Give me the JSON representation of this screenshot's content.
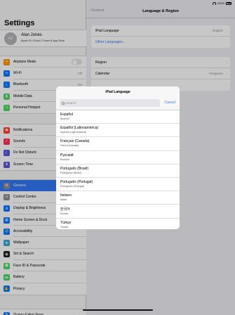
{
  "status": {
    "time": "10:00",
    "battery": "100%"
  },
  "sidebar": {
    "title": "Settings",
    "profile": {
      "initials": "AJ",
      "name": "Alan Jones",
      "subtitle": "Apple ID, iCloud, iTunes & App Store"
    },
    "group1": [
      {
        "label": "Airplane Mode",
        "icon": "airplane-icon",
        "color": "#ff9500",
        "toggle": "off"
      },
      {
        "label": "Wi-Fi",
        "icon": "wifi-icon",
        "color": "#007aff",
        "value": "Off"
      },
      {
        "label": "Bluetooth",
        "icon": "bluetooth-icon",
        "color": "#007aff",
        "value": "On"
      },
      {
        "label": "Mobile Data",
        "icon": "antenna-icon",
        "color": "#4cd964"
      },
      {
        "label": "Personal Hotspot",
        "icon": "hotspot-icon",
        "color": "#4cd964"
      }
    ],
    "group2": [
      {
        "label": "Notifications",
        "icon": "notifications-icon",
        "color": "#ff3b30"
      },
      {
        "label": "Sounds",
        "icon": "speaker-icon",
        "color": "#ff2d55"
      },
      {
        "label": "Do Not Disturb",
        "icon": "moon-icon",
        "color": "#5856d6"
      },
      {
        "label": "Screen Time",
        "icon": "hourglass-icon",
        "color": "#5856d6"
      }
    ],
    "group3": [
      {
        "label": "General",
        "icon": "gear-icon",
        "color": "#8e8e93",
        "selected": true
      },
      {
        "label": "Control Centre",
        "icon": "control-centre-icon",
        "color": "#8e8e93"
      },
      {
        "label": "Display & Brightness",
        "icon": "display-icon",
        "color": "#007aff"
      },
      {
        "label": "Home Screen & Dock",
        "icon": "home-screen-icon",
        "color": "#007aff"
      },
      {
        "label": "Accessibility",
        "icon": "accessibility-icon",
        "color": "#007aff"
      },
      {
        "label": "Wallpaper",
        "icon": "wallpaper-icon",
        "color": "#34aadc"
      },
      {
        "label": "Siri & Search",
        "icon": "siri-icon",
        "color": "#222222"
      },
      {
        "label": "Face ID & Passcode",
        "icon": "face-id-icon",
        "color": "#4cd964"
      },
      {
        "label": "Battery",
        "icon": "battery-icon",
        "color": "#4cd964"
      },
      {
        "label": "Privacy",
        "icon": "hand-icon",
        "color": "#007aff"
      }
    ],
    "group4": [
      {
        "label": "iTunes & App Store",
        "icon": "app-store-icon",
        "color": "#007aff"
      }
    ]
  },
  "detail": {
    "back_label": "General",
    "title": "Language & Region",
    "language_row": {
      "label": "iPad Language",
      "value": "English"
    },
    "other_languages": "Other Languages...",
    "region_rows": [
      {
        "label": "Region",
        "value": ""
      },
      {
        "label": "Calendar",
        "value": "Gregorian"
      },
      {
        "label": "",
        "value": ""
      }
    ]
  },
  "modal": {
    "title": "iPad Language",
    "search_placeholder": "Search",
    "cancel_label": "Cancel",
    "languages": [
      {
        "name": "Español",
        "sub": "Spanish"
      },
      {
        "name": "Español (Latinoamérica)",
        "sub": "Spanish (Latin America)"
      },
      {
        "name": "Français (Canada)",
        "sub": "French (Canada)"
      },
      {
        "name": "Русский",
        "sub": "Russian"
      },
      {
        "name": "Português (Brasil)",
        "sub": "Portuguese (Brazil)"
      },
      {
        "name": "Português (Portugal)",
        "sub": "Portuguese (Portugal)"
      },
      {
        "name": "Italiano",
        "sub": "Italian"
      },
      {
        "name": "한국어",
        "sub": "Korean"
      },
      {
        "name": "Türkçe",
        "sub": "Turkish"
      }
    ]
  }
}
